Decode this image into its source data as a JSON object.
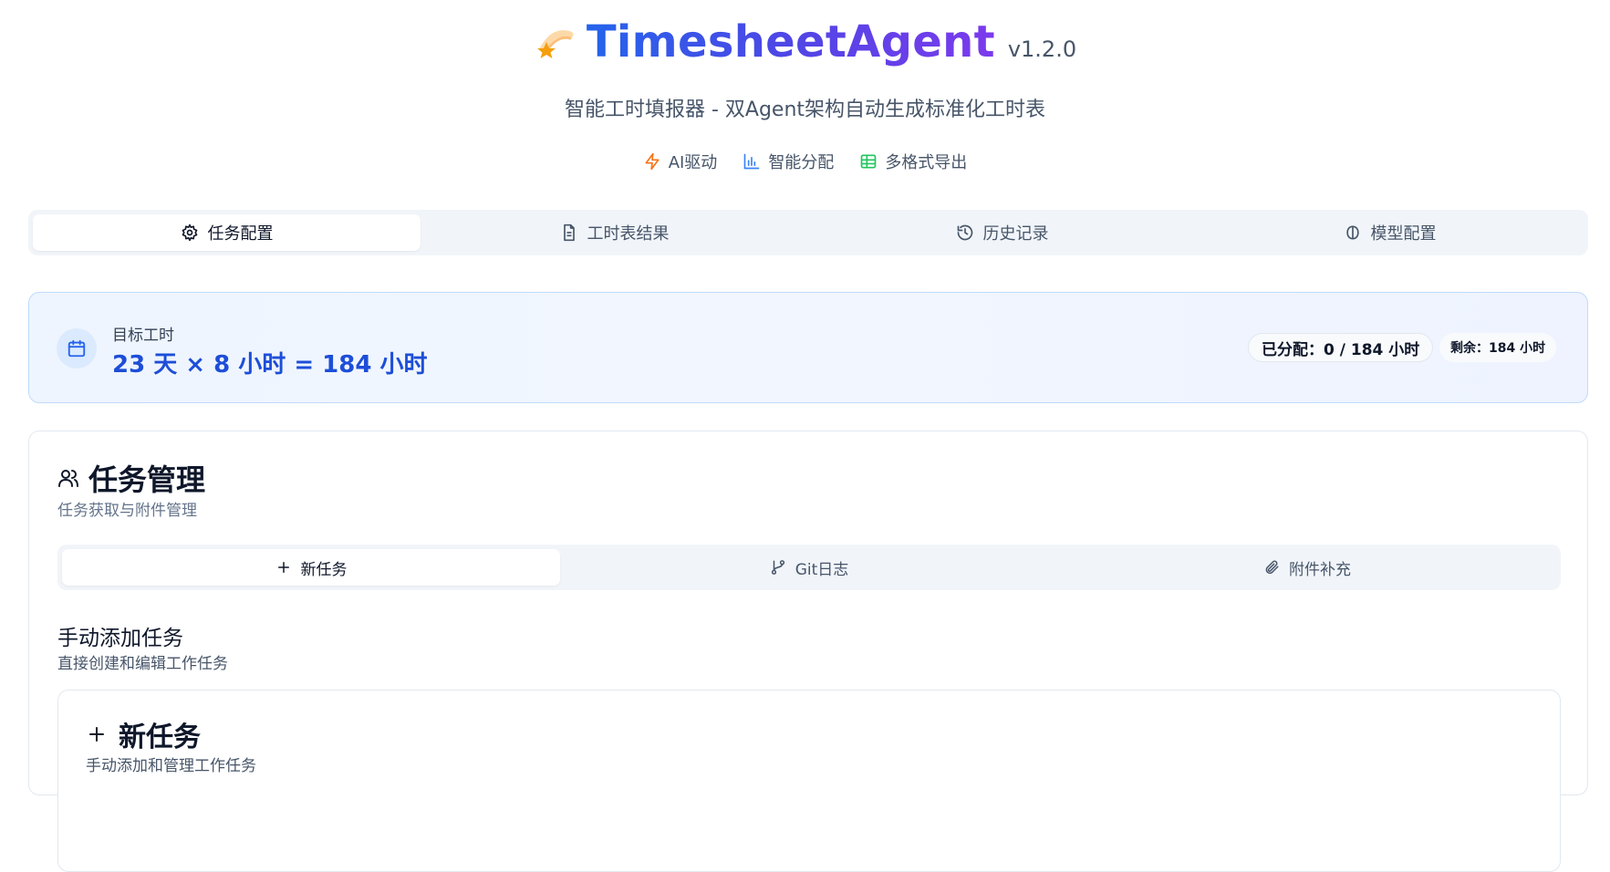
{
  "header": {
    "logo_icon": "shooting-star-icon",
    "title": "TimesheetAgent",
    "version": "v1.2.0",
    "subtitle": "智能工时填报器 - 双Agent架构自动生成标准化工时表",
    "features": [
      {
        "label": "AI驱动",
        "icon": "lightning-icon",
        "color": "#f97316"
      },
      {
        "label": "智能分配",
        "icon": "bar-chart-icon",
        "color": "#3b82f6"
      },
      {
        "label": "多格式导出",
        "icon": "table-icon",
        "color": "#22c55e"
      }
    ]
  },
  "main_tabs": [
    {
      "label": "任务配置",
      "icon": "gear-icon",
      "active": true
    },
    {
      "label": "工时表结果",
      "icon": "document-icon",
      "active": false
    },
    {
      "label": "历史记录",
      "icon": "history-icon",
      "active": false
    },
    {
      "label": "模型配置",
      "icon": "brain-icon",
      "active": false
    }
  ],
  "target": {
    "icon": "calendar-icon",
    "label": "目标工时",
    "value": "23 天 × 8 小时 = 184 小时",
    "allocated": "已分配：0 / 184 小时",
    "remaining": "剩余：184 小时"
  },
  "task_management": {
    "icon": "users-icon",
    "title": "任务管理",
    "subtitle": "任务获取与附件管理",
    "tabs": [
      {
        "label": "新任务",
        "icon": "plus-icon",
        "active": true
      },
      {
        "label": "Git日志",
        "icon": "git-branch-icon",
        "active": false
      },
      {
        "label": "附件补充",
        "icon": "paperclip-icon",
        "active": false
      }
    ],
    "manual": {
      "title": "手动添加任务",
      "desc": "直接创建和编辑工作任务"
    },
    "new_task": {
      "title": "新任务",
      "desc": "手动添加和管理工作任务"
    }
  },
  "colors": {
    "accent_blue": "#1d4ed8",
    "title_gradient_start": "#2563eb",
    "title_gradient_end": "#7c3aed"
  }
}
